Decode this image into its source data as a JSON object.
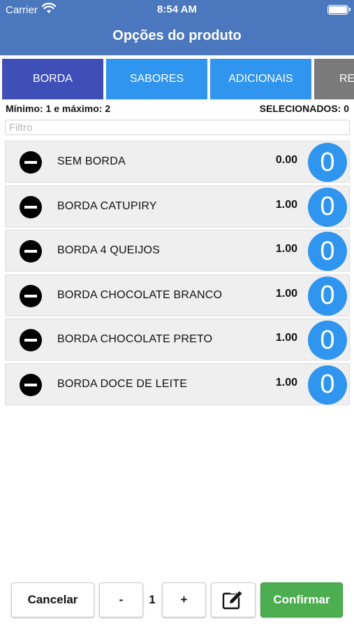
{
  "status_bar": {
    "carrier": "Carrier",
    "time": "8:54 AM"
  },
  "header": {
    "title": "Opções do produto"
  },
  "tabs": [
    {
      "label": "BORDA",
      "state": "active"
    },
    {
      "label": "SABORES",
      "state": "normal"
    },
    {
      "label": "ADICIONAIS",
      "state": "normal"
    },
    {
      "label": "RE",
      "state": "partial"
    }
  ],
  "limits": {
    "min_max": "Mínimo: 1 e máximo: 2",
    "selected": "SELECIONADOS: 0"
  },
  "filter": {
    "placeholder": "Filtro",
    "value": ""
  },
  "items": [
    {
      "name": "SEM BORDA",
      "price": "0.00",
      "qty": "0"
    },
    {
      "name": "BORDA CATUPIRY",
      "price": "1.00",
      "qty": "0"
    },
    {
      "name": "BORDA 4 QUEIJOS",
      "price": "1.00",
      "qty": "0"
    },
    {
      "name": "BORDA CHOCOLATE BRANCO",
      "price": "1.00",
      "qty": "0"
    },
    {
      "name": "BORDA CHOCOLATE PRETO",
      "price": "1.00",
      "qty": "0"
    },
    {
      "name": "BORDA DOCE DE LEITE",
      "price": "1.00",
      "qty": "0"
    }
  ],
  "footer": {
    "cancel_label": "Cancelar",
    "minus_label": "-",
    "quantity": "1",
    "plus_label": "+",
    "edit_icon": "edit-note-icon",
    "confirm_label": "Confirmar"
  },
  "colors": {
    "header_bg": "#4a77bd",
    "tab_active": "#3f4fb8",
    "tab_normal": "#2f95ee",
    "tab_grey": "#7a7a7a",
    "qty_badge": "#2f95ee",
    "confirm": "#4cae50"
  }
}
